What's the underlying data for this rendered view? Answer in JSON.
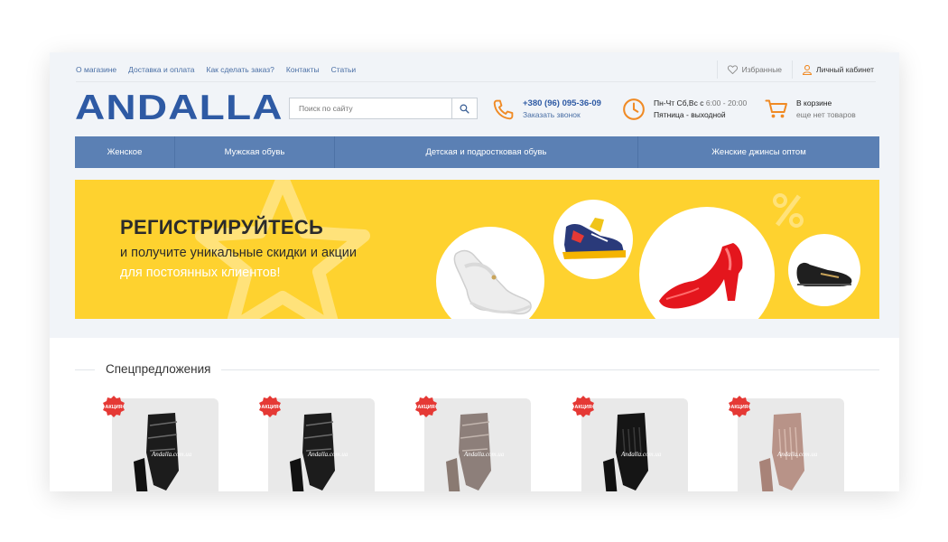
{
  "topbar": {
    "links": [
      "О магазине",
      "Доставка и оплата",
      "Как сделать заказ?",
      "Контакты",
      "Статьи"
    ],
    "favorites": "Избранные",
    "account": "Личный кабинет"
  },
  "logo": "ANDALLA",
  "search": {
    "placeholder": "Поиск по сайту"
  },
  "phone": {
    "number": "+380 (96) 095-36-09",
    "callback": "Заказать звонок"
  },
  "hours": {
    "line1": "Пн-Чт Сб,Вс с",
    "time": "6:00 - 20:00",
    "line2": "Пятница - выходной"
  },
  "cart": {
    "line1": "В корзине",
    "line2": "еще нет товаров"
  },
  "mainnav": [
    "Женское",
    "Мужская обувь",
    "Детская и подростковая обувь",
    "Женские джинсы оптом"
  ],
  "banner": {
    "title": "РЕГИСТРИРУЙТЕСЬ",
    "line2": "и получите уникальные скидки и акции",
    "line3": "для постоянных клиентов!"
  },
  "specials": {
    "title": "Спецпредложения",
    "badge": "АКЦИЯ",
    "watermark": "Andalla.com.ua"
  },
  "colors": {
    "brand": "#2e5aa4",
    "nav": "#5b80b4",
    "accent": "#f08a24",
    "banner": "#fed22f",
    "badge": "#e53935"
  },
  "icons": [
    "heart-icon",
    "user-icon",
    "search-icon",
    "phone-icon",
    "clock-icon",
    "cart-icon"
  ]
}
